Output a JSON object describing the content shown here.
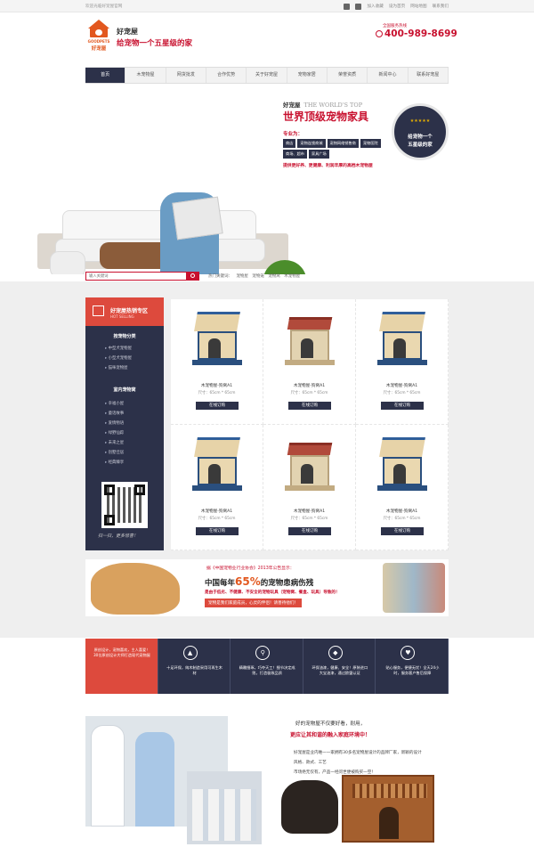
{
  "topbar": {
    "welcome": "欢迎光临好宠屋官网",
    "links": [
      "加入收藏",
      "设为首页",
      "网站地图",
      "联系我们"
    ]
  },
  "header": {
    "logo_en": "GOODPETS",
    "logo_cn": "好宠屋",
    "brand_name": "好宠屋",
    "slogan": "给宠物一个五星级的家",
    "hotline_label": "全国服务热线",
    "hotline": "400-989-8699"
  },
  "nav": {
    "items": [
      "首页",
      "木宠物屋",
      "网货批发",
      "合作优势",
      "关于好宠屋",
      "宠物家居",
      "荣誉资质",
      "新闻中心",
      "联系好宠屋"
    ],
    "active": "首页"
  },
  "banner": {
    "brand_small": "好宠屋",
    "brand_en": "THE WORLD'S TOP",
    "title": "世界顶级宠物家具",
    "for_label": "专业为：",
    "tags": [
      "商店",
      "宠物连锁商城",
      "宠物网络销售商",
      "宠物医院",
      "商场、超市",
      "家具广场"
    ],
    "desc": "提供更好养、更健康、利润丰厚的高档木宠物屋",
    "badge_stars": "★★★★★",
    "badge_line1": "给宠物一个",
    "badge_line2": "五星级的家"
  },
  "search": {
    "placeholder": "输入关键词",
    "hot_label": "热门关键词：",
    "hot_words": [
      "宠物屋",
      "宠物笼",
      "宠物窝",
      "木宠物屋"
    ]
  },
  "sidebar": {
    "title": "好宠屋热销专区",
    "title_en": "HOT SELLING",
    "cat1_title": "按宠物分类",
    "cat1_items": [
      "中型犬宠物屋",
      "小型犬宠物屋",
      "猫咪宠物屋"
    ],
    "cat2_title": "室内宠物窝",
    "cat2_items": [
      "幸福小屋",
      "童话故事",
      "爱情物语",
      "绿野仙踪",
      "未来之星",
      "别墅佳居",
      "经典臻享"
    ],
    "signature": "扫一扫，更多惊喜！"
  },
  "products": [
    {
      "name": "木宠物屋-狗窝A1",
      "size": "尺寸：65cm * 65cm",
      "button": "在线订购",
      "style": "blue"
    },
    {
      "name": "木宠物屋-狗窝A1",
      "size": "尺寸：65cm * 65cm",
      "button": "在线订购",
      "style": "red"
    },
    {
      "name": "木宠物屋-狗窝A1",
      "size": "尺寸：65cm * 65cm",
      "button": "在线订购",
      "style": "blue"
    },
    {
      "name": "木宠物屋-狗窝A1",
      "size": "尺寸：65cm * 65cm",
      "button": "在线订购",
      "style": "blue"
    },
    {
      "name": "木宠物屋-狗窝A1",
      "size": "尺寸：65cm * 65cm",
      "button": "在线订购",
      "style": "red"
    },
    {
      "name": "木宠物屋-狗窝A1",
      "size": "尺寸：65cm * 65cm",
      "button": "在线订购",
      "style": "blue"
    }
  ],
  "ad": {
    "note": "据《中国宠物业行业协会》2013年公告显示：",
    "big_pre": "中国每年",
    "big_pct": "65%",
    "big_post": "的宠物患病伤残",
    "sub": "是由于低劣、不健康、不安全的宠物玩具（宠物窝、餐盒、玩具）导致的！",
    "button": "宠物是我们家庭成员，心灵的伴侣！请善待他们！"
  },
  "features": [
    {
      "icon": "",
      "text": "原创设计，宠物喜欢，主人喜爱！30位原创设计大师打造现代宠物屋"
    },
    {
      "icon": "tree-icon",
      "text": "十足环保，纯木制造采用可再生木材"
    },
    {
      "icon": "search-icon",
      "text": "精雕细琢，巧夺天工！细节决定成败，打造极致品质"
    },
    {
      "icon": "shield-icon",
      "text": "环保油漆，健康、安全！原装进口大宝油漆，通过欧盟认证"
    },
    {
      "icon": "heart-icon",
      "text": "贴心服务，便捷无忧！全天24小时，服务客户售后保障"
    }
  ],
  "about": {
    "line1": "好的宠物屋不仅要好看，耐用，",
    "line2": "更应让其和谐的融入家庭环境中！",
    "para1": "好宠屋是业内唯一一家拥有30多名宠物屋设计的品牌厂家，新颖的设计",
    "para2": "风格、款式、工艺",
    "para3": "市场绝无仅有，产品一经问世便被购买一空！"
  }
}
